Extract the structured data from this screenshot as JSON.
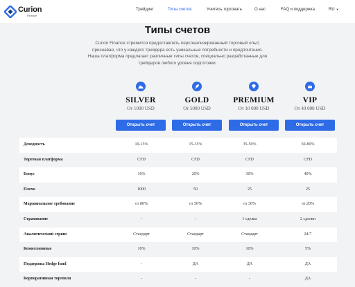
{
  "header": {
    "logo_text": "Curion",
    "logo_sub": "Finance",
    "nav": [
      "Трейдинг",
      "Типы счетов",
      "Учитесь торговать",
      "О нас",
      "FAQ и поддержка"
    ],
    "active_nav": "Типы счетов",
    "language": "RU"
  },
  "main": {
    "title": "Типы счетов",
    "intro": "Curion Finance стремится предоставлять персонализированный торговый опыт, признавая, что у каждого трейдера есть уникальные потребности и предпочтения. Наша платформа предлагает различные типы счетов, специально разработанные для трейдеров любого уровня подготовки."
  },
  "plans": [
    {
      "name": "SILVER",
      "price": "От 1000 USD",
      "button": "Открыть счет",
      "icon": "mountain-icon"
    },
    {
      "name": "GOLD",
      "price": "От 5000 USD",
      "button": "Открыть счет",
      "icon": "rocket-icon"
    },
    {
      "name": "PREMIUM",
      "price": "От 10 000 USD",
      "button": "Открыть счет",
      "icon": "diamond-icon"
    },
    {
      "name": "VIP",
      "price": "От 40 000 USD",
      "button": "Открыть счет",
      "icon": "crown-icon"
    }
  ],
  "colors": {
    "accent": "#2e6be6",
    "row_alt": "#ffffff",
    "background": "#f2f3f5"
  },
  "table": {
    "rows": [
      {
        "label": "Доходность",
        "values": [
          "10-15%",
          "15-35%",
          "35-50%",
          "50-80%"
        ]
      },
      {
        "label": "Торговая платформа",
        "values": [
          "CFD",
          "CFD",
          "CFD",
          "CFD"
        ]
      },
      {
        "label": "Бонус",
        "values": [
          "10%",
          "20%",
          "30%",
          "40%"
        ]
      },
      {
        "label": "Плечо",
        "values": [
          "1000",
          "50",
          "25",
          "25"
        ]
      },
      {
        "label": "Маржинальное требование",
        "values": [
          "от 80%",
          "от 50%",
          "от 30%",
          "от 20%"
        ]
      },
      {
        "label": "Страхование",
        "values": [
          "-",
          "-",
          "1 сделка",
          "2 сделки"
        ]
      },
      {
        "label": "Аналитический сервис",
        "values": [
          "Стандарт",
          "Стандарт",
          "Стандарт",
          "24/7"
        ]
      },
      {
        "label": "Комиссионные",
        "values": [
          "10%",
          "10%",
          "10%",
          "5%"
        ]
      },
      {
        "label": "Поддержка Hedge fund",
        "values": [
          "-",
          "ДА",
          "ДА",
          "ДА"
        ]
      },
      {
        "label": "Корпоративная торговля",
        "values": [
          "-",
          "-",
          "-",
          "ДА"
        ]
      }
    ]
  }
}
